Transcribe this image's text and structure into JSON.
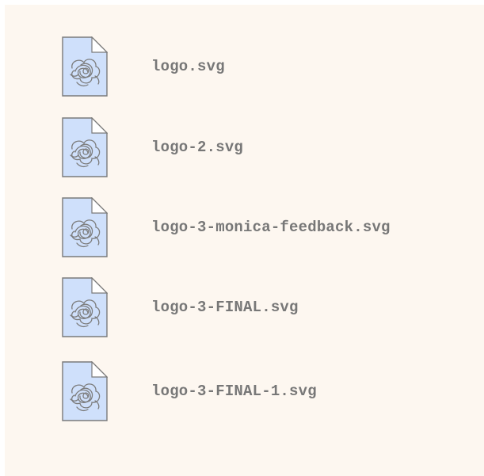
{
  "colors": {
    "background": "#fdf7f0",
    "icon_fill": "#cfe0fb",
    "icon_stroke": "#7a7a7a",
    "label_text": "#777777"
  },
  "files": [
    {
      "name": "logo.svg",
      "icon": "svg-file-icon"
    },
    {
      "name": "logo-2.svg",
      "icon": "svg-file-icon"
    },
    {
      "name": "logo-3-monica-feedback.svg",
      "icon": "svg-file-icon"
    },
    {
      "name": "logo-3-FINAL.svg",
      "icon": "svg-file-icon"
    },
    {
      "name": "logo-3-FINAL-1.svg",
      "icon": "svg-file-icon"
    }
  ]
}
